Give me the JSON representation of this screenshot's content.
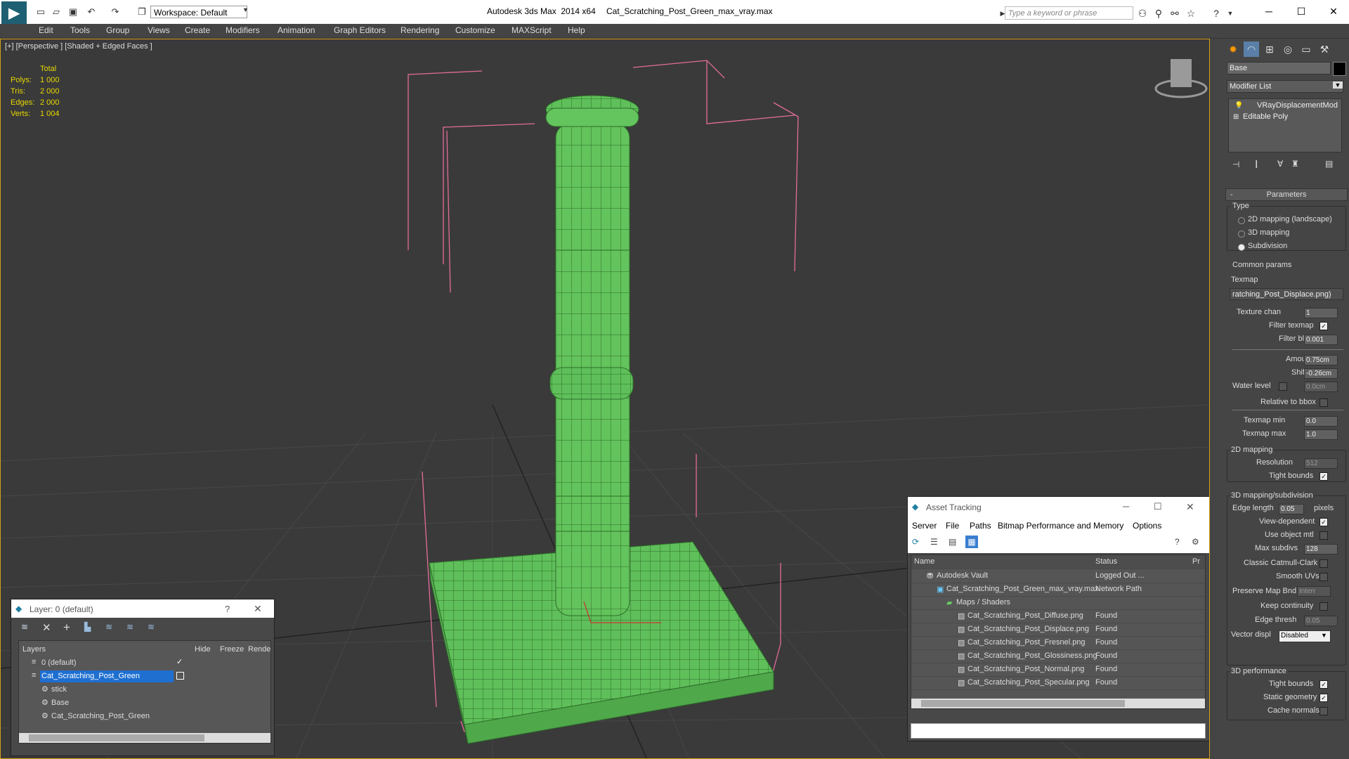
{
  "titlebar": {
    "app_title": "Autodesk 3ds Max  2014 x64",
    "file_title": "Cat_Scratching_Post_Green_max_vray.max",
    "workspace": "Workspace: Default",
    "search_placeholder": "Type a keyword or phrase"
  },
  "menu": [
    "Edit",
    "Tools",
    "Group",
    "Views",
    "Create",
    "Modifiers",
    "Animation",
    "Graph Editors",
    "Rendering",
    "Customize",
    "MAXScript",
    "Help"
  ],
  "viewport": {
    "label": "[+] [Perspective ] [Shaded + Edged Faces ]",
    "stats": {
      "header": "Total",
      "rows": [
        {
          "label": "Polys:",
          "value": "1 000"
        },
        {
          "label": "Tris:",
          "value": "2 000"
        },
        {
          "label": "Edges:",
          "value": "2 000"
        },
        {
          "label": "Verts:",
          "value": "1 004"
        }
      ]
    }
  },
  "layer_window": {
    "title": "Layer: 0 (default)",
    "help": "?",
    "columns": [
      "Layers",
      "Hide",
      "Freeze",
      "Rende"
    ],
    "rows": [
      {
        "name": "0 (default)"
      },
      {
        "name": "Cat_Scratching_Post_Green"
      },
      {
        "name": "stick"
      },
      {
        "name": "Base"
      },
      {
        "name": "Cat_Scratching_Post_Green"
      }
    ]
  },
  "asset_tracking": {
    "title": "Asset Tracking",
    "menu": [
      "Server",
      "File",
      "Paths",
      "Bitmap Performance and Memory",
      "Options"
    ],
    "columns": [
      "Name",
      "Status",
      "Pr"
    ],
    "rows": [
      {
        "name": "Autodesk Vault",
        "status": "Logged Out ..."
      },
      {
        "name": "Cat_Scratching_Post_Green_max_vray.max",
        "status": "Network Path"
      },
      {
        "name": "Maps / Shaders",
        "status": ""
      },
      {
        "name": "Cat_Scratching_Post_Diffuse.png",
        "status": "Found"
      },
      {
        "name": "Cat_Scratching_Post_Displace.png",
        "status": "Found"
      },
      {
        "name": "Cat_Scratching_Post_Fresnel.png",
        "status": "Found"
      },
      {
        "name": "Cat_Scratching_Post_Glossiness.png",
        "status": "Found"
      },
      {
        "name": "Cat_Scratching_Post_Normal.png",
        "status": "Found"
      },
      {
        "name": "Cat_Scratching_Post_Specular.png",
        "status": "Found"
      }
    ]
  },
  "command_panel": {
    "object_name": "Base",
    "modifier_list": "Modifier List",
    "stack": [
      "VRayDisplacementMod",
      "Editable Poly"
    ],
    "rollout_title": "Parameters",
    "type_title": "Type",
    "type_options": [
      "2D mapping (landscape)",
      "3D mapping",
      "Subdivision"
    ],
    "common_title": "Common params",
    "texmap_label": "Texmap",
    "texmap_value": "ratching_Post_Displace.png)",
    "texture_chan_label": "Texture chan",
    "texture_chan": "1",
    "filter_texmap": "Filter texmap",
    "filter_blur_label": "Filter blur",
    "filter_blur": "0.001",
    "amount_label": "Amount",
    "amount": "0.75cm",
    "shift_label": "Shift",
    "shift": "-0.26cm",
    "water_level_label": "Water level",
    "water_level": "0.0cm",
    "relative_bbox": "Relative to bbox",
    "texmap_min_label": "Texmap min",
    "texmap_min": "0.0",
    "texmap_max_label": "Texmap max",
    "texmap_max": "1.0",
    "mapping2d_title": "2D mapping",
    "resolution_label": "Resolution",
    "resolution": "512",
    "tight_bounds": "Tight bounds",
    "mapping3d_title": "3D mapping/subdivision",
    "edge_length_label": "Edge length",
    "edge_length": "0.05",
    "pixels": "pixels",
    "view_dependent": "View-dependent",
    "use_object_mtl": "Use object mtl",
    "max_subdivs_label": "Max subdivs",
    "max_subdivs": "128",
    "classic_catmull": "Classic Catmull-Clark",
    "smooth_uvs": "Smooth UVs",
    "preserve_map_label": "Preserve Map Bnd",
    "preserve_map": "Interr",
    "keep_continuity": "Keep continuity",
    "edge_thresh_label": "Edge thresh",
    "edge_thresh": "0.05",
    "vector_disp_label": "Vector displ",
    "vector_disp": "Disabled",
    "perf_title": "3D performance",
    "perf_tight_bounds": "Tight bounds",
    "static_geometry": "Static geometry",
    "cache_normals": "Cache normals"
  },
  "colors": {
    "accent": "#1e6fd0",
    "viewport_border": "#d4a017",
    "stats": "#e8d800",
    "mesh_green": "#5fbf5a",
    "bbox_pink": "#e36d9a"
  }
}
